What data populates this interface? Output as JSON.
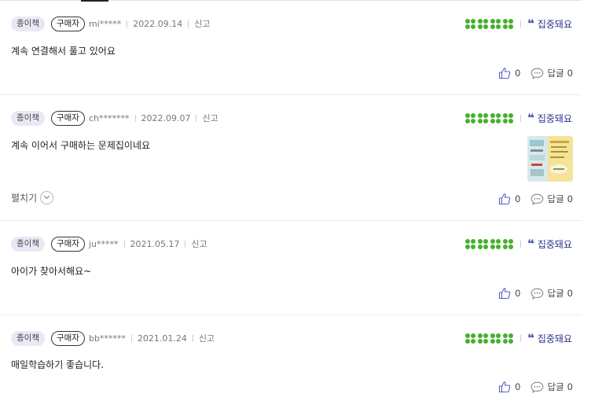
{
  "reviews": [
    {
      "badge_type": "종이책",
      "badge_buyer": "구매자",
      "user": "mi*****",
      "date": "2022.09.14",
      "report": "신고",
      "keyword": "집중돼요",
      "content": "계속 연결해서 풀고 있어요",
      "likes": "0",
      "reply_label": "답글",
      "replies": "0",
      "has_image": false,
      "expand_label": ""
    },
    {
      "badge_type": "종이책",
      "badge_buyer": "구매자",
      "user": "ch*******",
      "date": "2022.09.07",
      "report": "신고",
      "keyword": "집중돼요",
      "content": "계속 이어서 구매하는 문제집이네요",
      "likes": "0",
      "reply_label": "답글",
      "replies": "0",
      "has_image": true,
      "expand_label": "펼치기"
    },
    {
      "badge_type": "종이책",
      "badge_buyer": "구매자",
      "user": "ju*****",
      "date": "2021.05.17",
      "report": "신고",
      "keyword": "집중돼요",
      "content": "아이가 찾아서해요~",
      "likes": "0",
      "reply_label": "답글",
      "replies": "0",
      "has_image": false,
      "expand_label": ""
    },
    {
      "badge_type": "종이책",
      "badge_buyer": "구매자",
      "user": "bb******",
      "date": "2021.01.24",
      "report": "신고",
      "keyword": "집중돼요",
      "content": "매일학습하기 좋습니다.",
      "likes": "0",
      "reply_label": "답글",
      "replies": "0",
      "has_image": false,
      "expand_label": ""
    }
  ],
  "colors": {
    "clover": "#45b02d",
    "keyword": "#2c2f8f",
    "badge_bg": "#e9e8f5"
  },
  "icons": {
    "rating": "clover-icon",
    "quote": "quote-icon",
    "like": "thumbs-up-icon",
    "reply": "speech-bubble-icon",
    "expand": "chevron-down-icon"
  }
}
